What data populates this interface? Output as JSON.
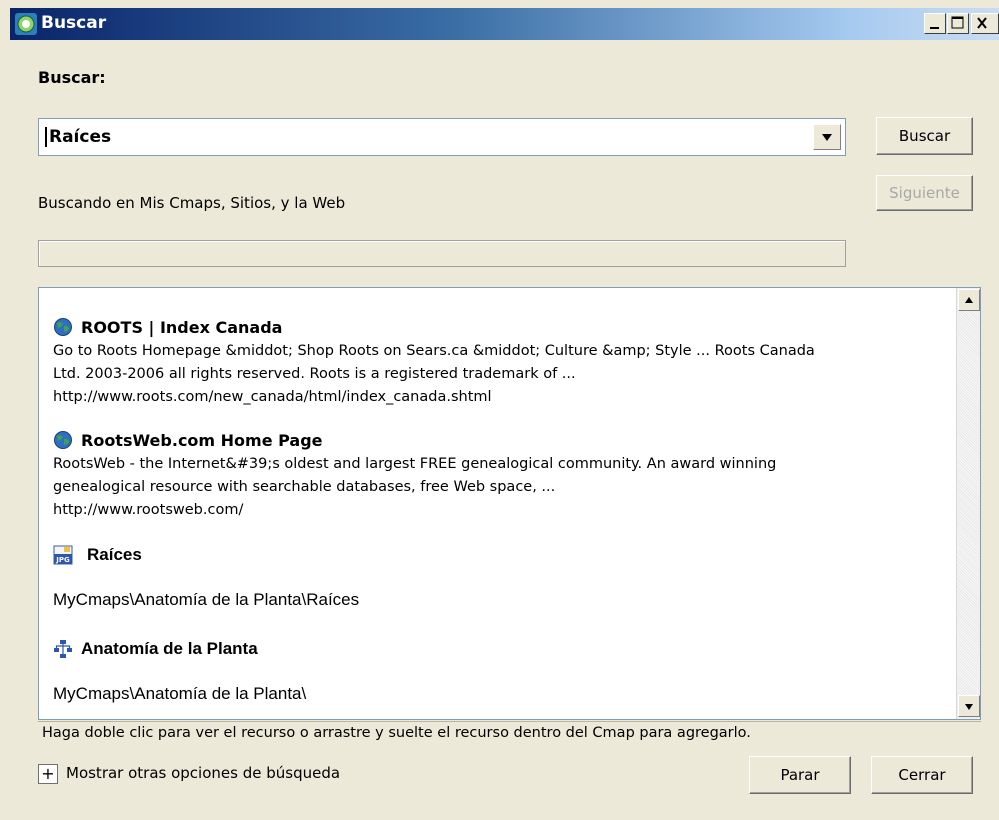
{
  "window": {
    "title": "Buscar",
    "controls": [
      "minimize-icon",
      "maximize-icon",
      "close-icon"
    ]
  },
  "search": {
    "label": "Buscar:",
    "query": "Raíces",
    "search_button": "Buscar",
    "next_button": "Siguiente",
    "status": "Buscando en Mis Cmaps, Sitios, y la Web"
  },
  "results": [
    {
      "icon": "globe-icon",
      "title": "ROOTS | Index Canada",
      "lines": [
        "Go to Roots Homepage &middot; Shop Roots on Sears.ca &middot; Culture &amp; Style ... Roots Canada",
        "Ltd. 2003-2006 all rights reserved. Roots is a registered trademark of ...",
        "http://www.roots.com/new_canada/html/index_canada.shtml"
      ]
    },
    {
      "icon": "globe-icon",
      "title": "RootsWeb.com Home Page",
      "lines": [
        "RootsWeb - the Internet&#39;s oldest and largest FREE genealogical community. An award  winning",
        "genealogical resource with searchable databases, free Web space, ...",
        "http://www.rootsweb.com/"
      ]
    },
    {
      "icon": "jpg-file-icon",
      "title": "Raíces",
      "path": "MyCmaps\\Anatomía de la Planta\\Raíces"
    },
    {
      "icon": "cmap-icon",
      "title": "Anatomía de la Planta",
      "path": "MyCmaps\\Anatomía de la Planta\\"
    }
  ],
  "status_bar": "Haga doble clic para ver el recurso o arrastre y suelte el recurso dentro del Cmap para agregarlo.",
  "footer": {
    "expand_symbol": "+",
    "more_options": "Mostrar otras opciones de búsqueda",
    "stop_button": "Parar",
    "close_button": "Cerrar"
  },
  "colors": {
    "titlebar_start": "#0a246a",
    "titlebar_end": "#c9dcf2",
    "dialog_bg": "#ece9d8",
    "disabled_text": "#a8a8a8"
  }
}
